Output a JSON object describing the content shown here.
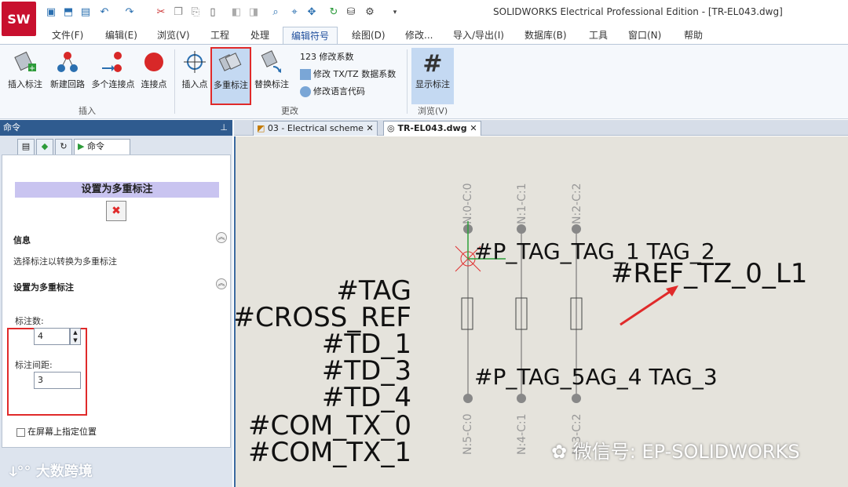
{
  "window": {
    "app_logo": "SW",
    "title": "SOLIDWORKS Electrical Professional Edition - [TR-EL043.dwg]"
  },
  "menu_tabs": [
    "文件(F)",
    "编辑(E)",
    "浏览(V)",
    "工程",
    "处理",
    "编辑符号",
    "绘图(D)",
    "修改...",
    "导入/导出(I)",
    "数据库(B)",
    "工具",
    "窗口(N)",
    "帮助"
  ],
  "ribbon": {
    "insert_buttons": [
      "插入标注",
      "新建回路",
      "多个连接点",
      "连接点"
    ],
    "insert_group": "插入",
    "modify_buttons": [
      "插入点",
      "多重标注",
      "替换标注"
    ],
    "modify_small": [
      "123 修改系数",
      "修改 TX/TZ 数据系数",
      "修改语言代码"
    ],
    "modify_group": "更改",
    "browse_button": "显示标注",
    "browse_group": "浏览(V)"
  },
  "left_panel": {
    "header": "命令",
    "tab_label": "命令",
    "title": "设置为多重标注",
    "section_info": "信息",
    "info_text": "选择标注以转换为多重标注",
    "section_settings": "设置为多重标注",
    "count_label": "标注数:",
    "count_value": "4",
    "spacing_label": "标注间距:",
    "spacing_value": "3",
    "checkbox_label": "在屏幕上指定位置",
    "watermark": "大数跨境"
  },
  "doc_tabs": [
    "03 - Electrical scheme",
    "TR-EL043.dwg"
  ],
  "canvas": {
    "left_tags": [
      "#TAG",
      "#CROSS_REF",
      "#TD_1",
      "#TD_3",
      "#TD_4",
      "#COM_TX_0",
      "#COM_TX_1"
    ],
    "top_nodes": [
      "N:0-C:0",
      "N:1-C:1",
      "N:2-C:2"
    ],
    "bottom_nodes": [
      "N:5-C:0",
      "N:4-C:1",
      "N:3-C:2"
    ],
    "top_tags": "#P_TAG_TAG_1 TAG_2",
    "bottom_tags": "#P_TAG_5AG_4 TAG_3",
    "ref_tag": "#REF_TZ_0_L1",
    "watermark": "微信号: EP-SOLIDWORKS"
  }
}
